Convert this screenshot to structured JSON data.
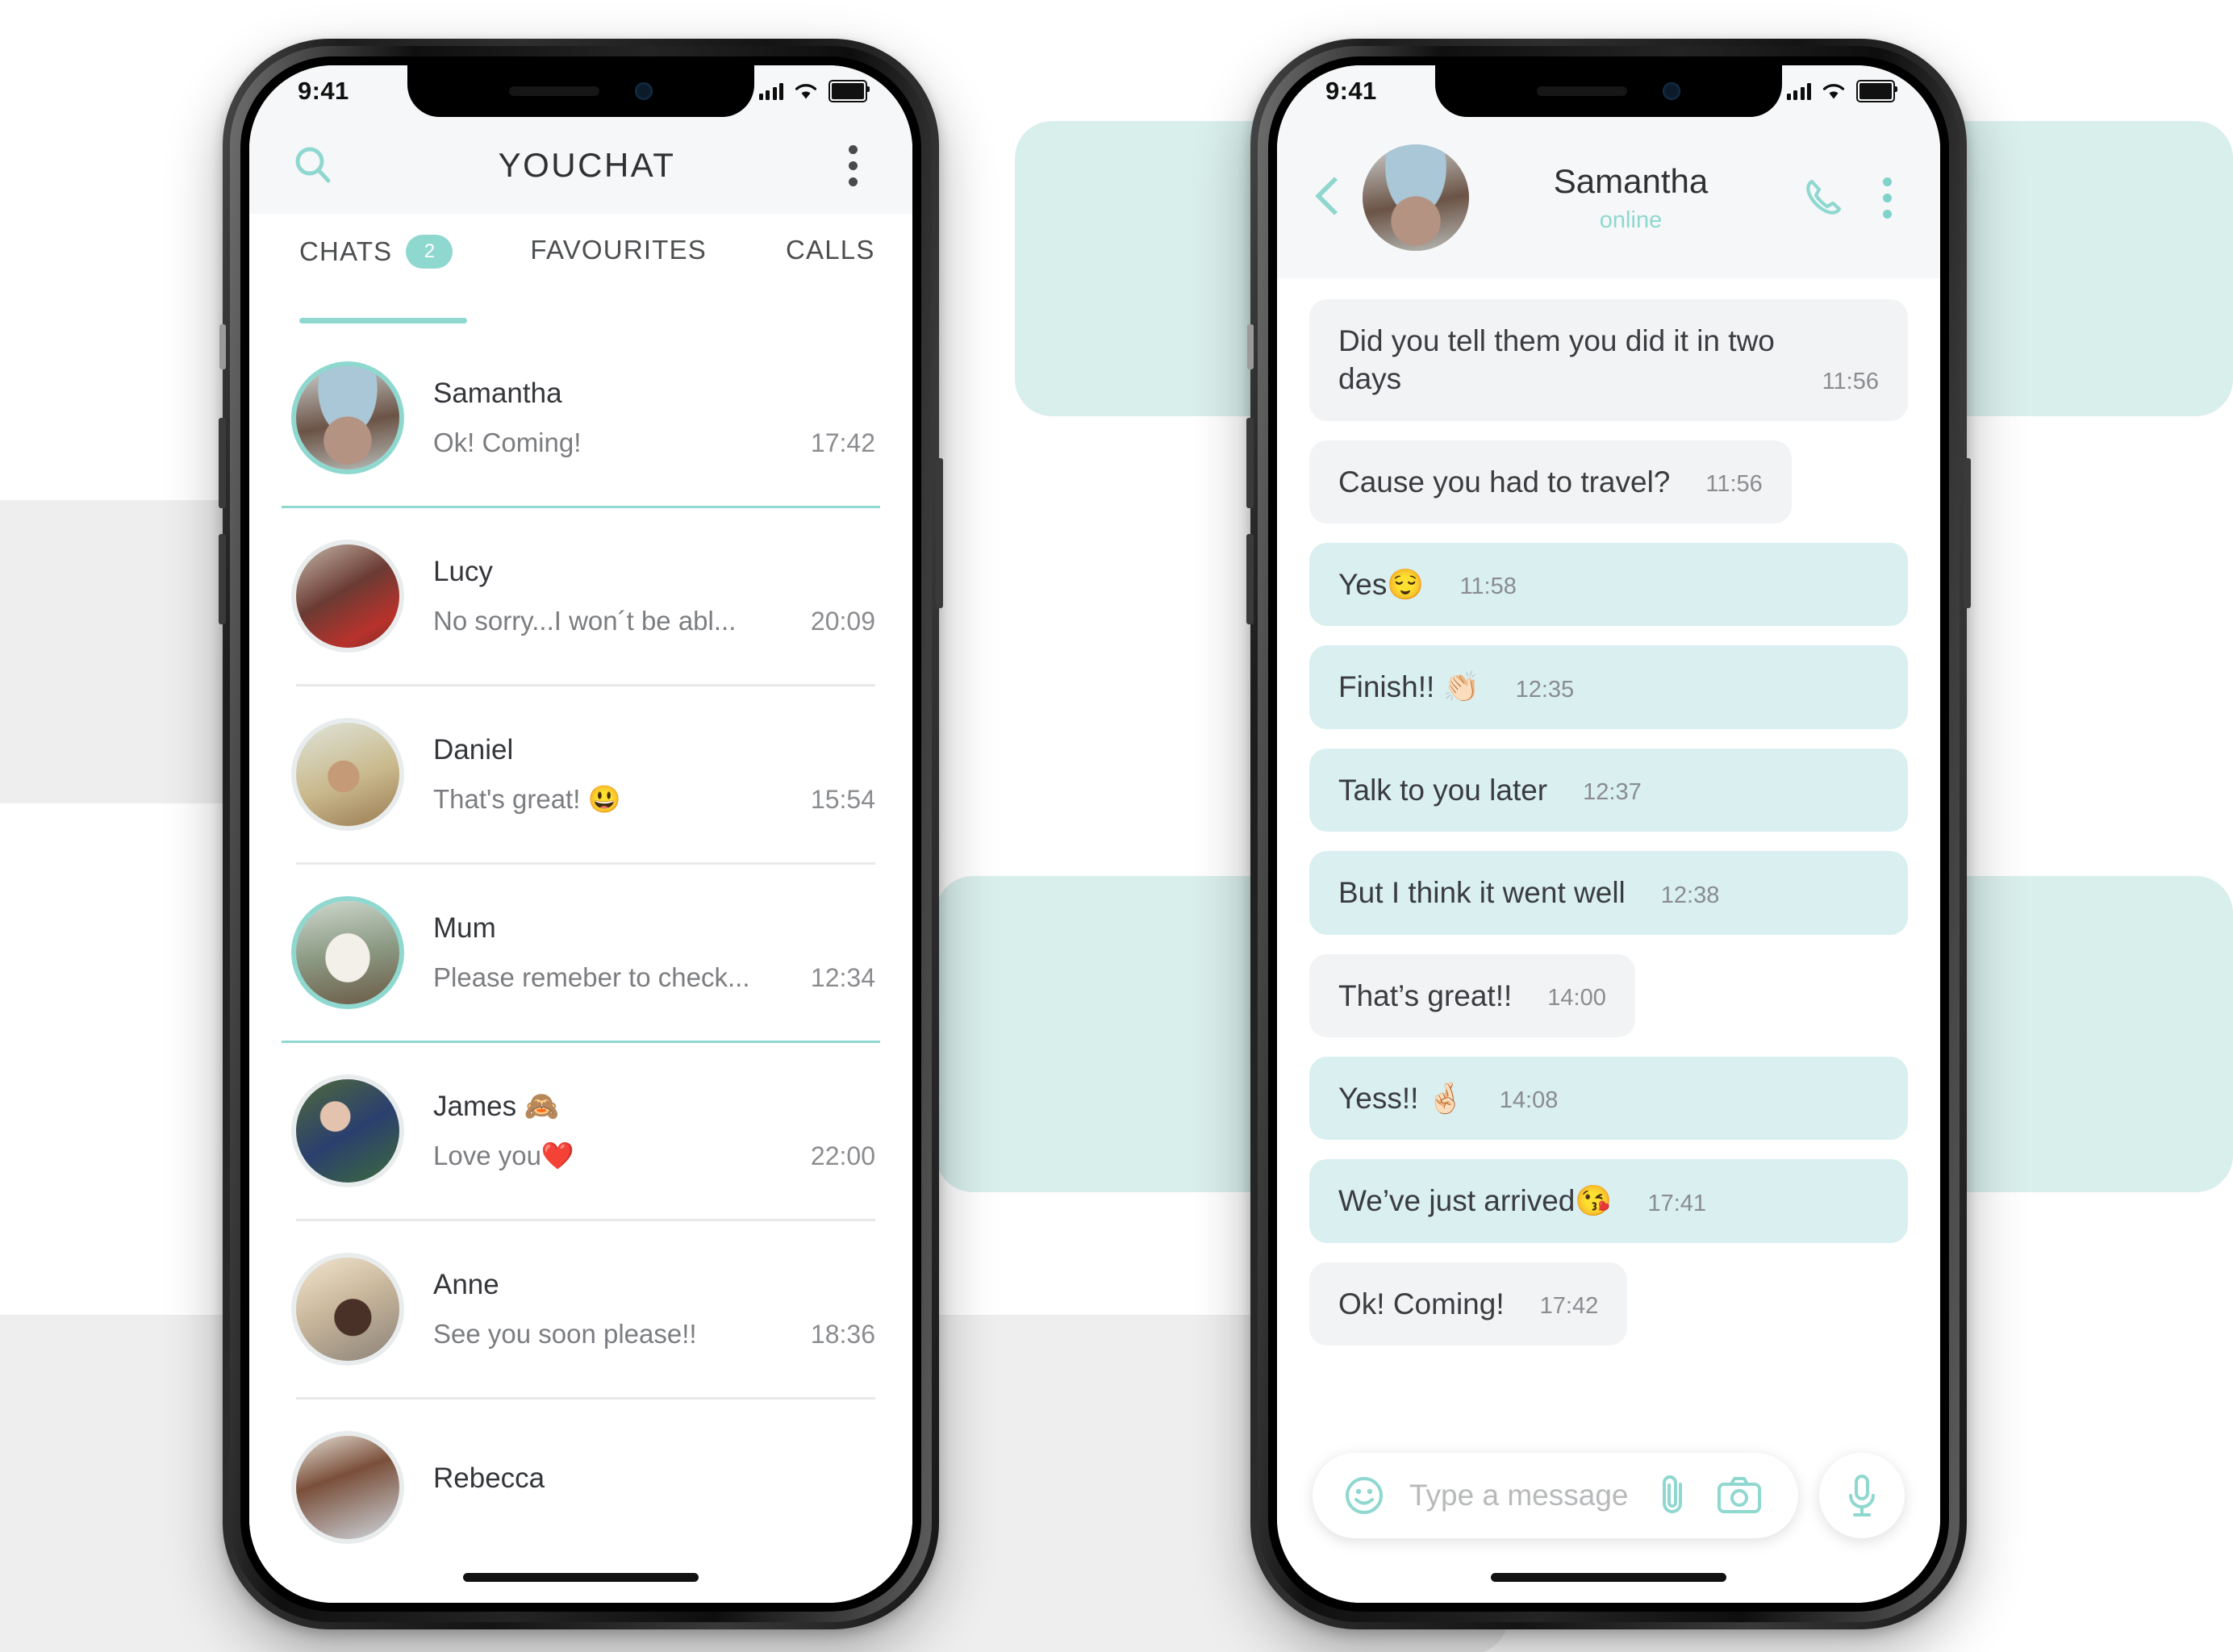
{
  "theme": {
    "accent": "#8fd8d0",
    "bubble_out": "#d9eff0",
    "bubble_in": "#f2f3f5",
    "bg_mint": "#d9efec",
    "bg_grey": "#eeeeee"
  },
  "status_bar": {
    "time": "9:41",
    "signal_icon": "signal-bars-icon",
    "wifi_icon": "wifi-icon",
    "battery_icon": "battery-icon"
  },
  "left_phone": {
    "app_title": "YOUCHAT",
    "search_icon": "search-icon",
    "menu_icon": "kebab-menu-icon",
    "tabs": [
      {
        "label": "CHATS",
        "badge": "2",
        "active": true
      },
      {
        "label": "FAVOURITES",
        "badge": "",
        "active": false
      },
      {
        "label": "CALLS",
        "badge": "",
        "active": false
      }
    ],
    "chats": [
      {
        "name": "Samantha",
        "preview": "Ok! Coming!",
        "time": "17:42",
        "unread": true,
        "divider": "teal"
      },
      {
        "name": "Lucy",
        "preview": "No sorry...I won´t be abl...",
        "time": "20:09",
        "unread": false,
        "divider": "grey"
      },
      {
        "name": "Daniel",
        "preview": "That's great! 😃",
        "time": "15:54",
        "unread": false,
        "divider": "grey"
      },
      {
        "name": "Mum",
        "preview": "Please remeber to check...",
        "time": "12:34",
        "unread": true,
        "divider": "teal"
      },
      {
        "name": "James 🙈",
        "preview": "Love you❤️",
        "time": "22:00",
        "unread": false,
        "divider": "grey"
      },
      {
        "name": "Anne",
        "preview": "See you soon please!!",
        "time": "18:36",
        "unread": false,
        "divider": "grey"
      },
      {
        "name": "Rebecca",
        "preview": "",
        "time": "",
        "unread": false,
        "divider": "none"
      }
    ]
  },
  "right_phone": {
    "back_icon": "back-chevron-icon",
    "contact_name": "Samantha",
    "contact_status": "online",
    "call_icon": "phone-call-icon",
    "menu_icon": "kebab-menu-icon",
    "messages": [
      {
        "text": "Did you tell them you did it in two days",
        "time": "11:56",
        "dir": "in",
        "wide": true
      },
      {
        "text": "Cause you had to travel?",
        "time": "11:56",
        "dir": "in",
        "wide": false
      },
      {
        "text": "Yes😌",
        "time": "11:58",
        "dir": "out",
        "wide": true
      },
      {
        "text": "Finish!! 👏🏻",
        "time": "12:35",
        "dir": "out",
        "wide": true
      },
      {
        "text": "Talk to you later",
        "time": "12:37",
        "dir": "out",
        "wide": true
      },
      {
        "text": "But I think it went well",
        "time": "12:38",
        "dir": "out",
        "wide": true
      },
      {
        "text": "That’s great!!",
        "time": "14:00",
        "dir": "in",
        "wide": false
      },
      {
        "text": "Yess!! 🤞🏻",
        "time": "14:08",
        "dir": "out",
        "wide": true
      },
      {
        "text": "We’ve just arrived😘",
        "time": "17:41",
        "dir": "out",
        "wide": true
      },
      {
        "text": "Ok! Coming!",
        "time": "17:42",
        "dir": "in",
        "wide": false
      }
    ],
    "composer": {
      "emoji_icon": "smiley-face-icon",
      "placeholder": "Type a message",
      "attach_icon": "paperclip-icon",
      "camera_icon": "camera-icon",
      "mic_icon": "microphone-icon"
    }
  }
}
